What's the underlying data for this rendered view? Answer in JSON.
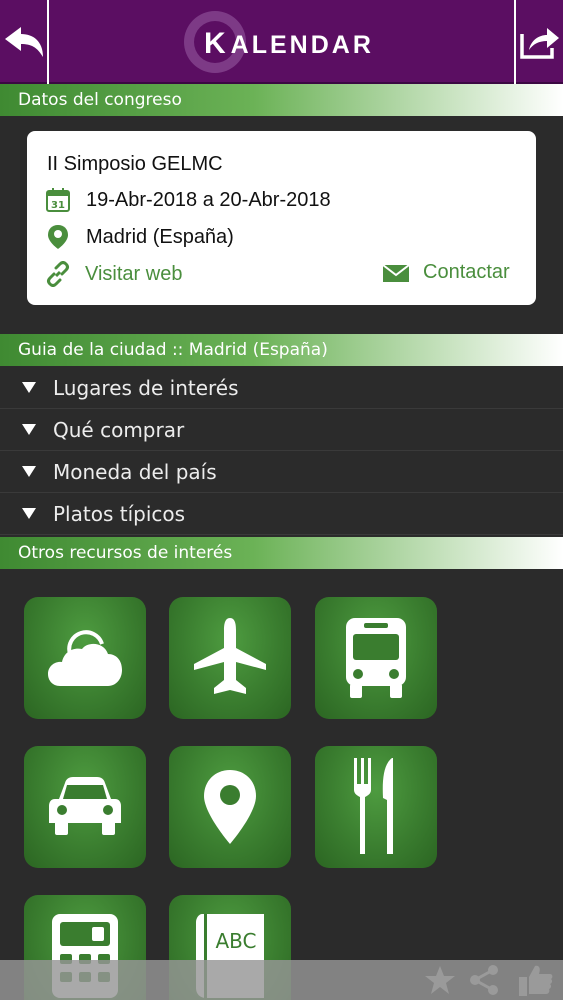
{
  "header": {
    "back_icon": "back-arrow-icon",
    "share_icon": "share-export-icon",
    "logo_first": "K",
    "logo_rest": "ALENDAR"
  },
  "sections": {
    "congress": "Datos del congreso",
    "city_guide": "Guia de la ciudad :: Madrid (España)",
    "resources": "Otros recursos de interés"
  },
  "congress": {
    "name": "II Simposio GELMC",
    "dates": "19-Abr-2018 a 20-Abr-2018",
    "location": "Madrid (España)",
    "website_label": "Visitar web",
    "contact_label": "Contactar"
  },
  "city_guide": {
    "items": [
      {
        "label": "Lugares de interés"
      },
      {
        "label": "Qué comprar"
      },
      {
        "label": "Moneda del país"
      },
      {
        "label": "Platos típicos"
      }
    ]
  },
  "resources": {
    "tiles": [
      {
        "icon": "weather-cloud-icon"
      },
      {
        "icon": "airplane-icon"
      },
      {
        "icon": "bus-icon"
      },
      {
        "icon": "car-icon"
      },
      {
        "icon": "map-pin-icon"
      },
      {
        "icon": "fork-knife-icon"
      },
      {
        "icon": "calculator-icon"
      },
      {
        "icon": "dictionary-icon",
        "text": "ABC"
      }
    ]
  },
  "bottom_bar": {
    "icons": [
      "star-icon",
      "share-icon",
      "thumbs-up-icon"
    ]
  },
  "colors": {
    "header_purple": "#5b0e62",
    "accent_green": "#4a8e3d",
    "background": "#2b2b2b"
  }
}
